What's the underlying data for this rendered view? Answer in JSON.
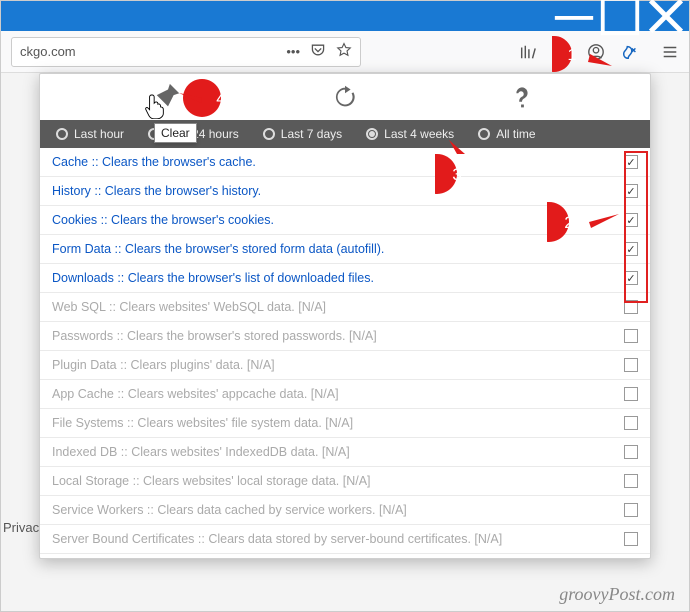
{
  "window": {
    "accent": "#1979d3"
  },
  "urlbar": {
    "text": "ckgo.com",
    "ellipsis": "•••"
  },
  "tooltip": {
    "text": "Clear"
  },
  "time_options": [
    {
      "label": "Last hour",
      "selected": false
    },
    {
      "label": "Last 24 hours",
      "selected": false
    },
    {
      "label": "Last 7 days",
      "selected": false
    },
    {
      "label": "Last 4 weeks",
      "selected": true
    },
    {
      "label": "All time",
      "selected": false
    }
  ],
  "rows": [
    {
      "label": "Cache :: Clears the browser's cache.",
      "enabled": true,
      "checked": true
    },
    {
      "label": "History :: Clears the browser's history.",
      "enabled": true,
      "checked": true
    },
    {
      "label": "Cookies :: Clears the browser's cookies.",
      "enabled": true,
      "checked": true
    },
    {
      "label": "Form Data :: Clears the browser's stored form data (autofill).",
      "enabled": true,
      "checked": true
    },
    {
      "label": "Downloads :: Clears the browser's list of downloaded files.",
      "enabled": true,
      "checked": true
    },
    {
      "label": "Web SQL :: Clears websites' WebSQL data. [N/A]",
      "enabled": false,
      "checked": false
    },
    {
      "label": "Passwords :: Clears the browser's stored passwords. [N/A]",
      "enabled": false,
      "checked": false
    },
    {
      "label": "Plugin Data :: Clears plugins' data. [N/A]",
      "enabled": false,
      "checked": false
    },
    {
      "label": "App Cache :: Clears websites' appcache data. [N/A]",
      "enabled": false,
      "checked": false
    },
    {
      "label": "File Systems :: Clears websites' file system data. [N/A]",
      "enabled": false,
      "checked": false
    },
    {
      "label": "Indexed DB :: Clears websites' IndexedDB data. [N/A]",
      "enabled": false,
      "checked": false
    },
    {
      "label": "Local Storage :: Clears websites' local storage data. [N/A]",
      "enabled": false,
      "checked": false
    },
    {
      "label": "Service Workers :: Clears data cached by service workers. [N/A]",
      "enabled": false,
      "checked": false
    },
    {
      "label": "Server Bound Certificates :: Clears data stored by server-bound certificates. [N/A]",
      "enabled": false,
      "checked": false
    }
  ],
  "callouts": {
    "c1": "1",
    "c2": "2",
    "c3": "3",
    "c4": "4"
  },
  "footer": {
    "privacy": "Privac",
    "watermark": "groovyPost.com"
  }
}
